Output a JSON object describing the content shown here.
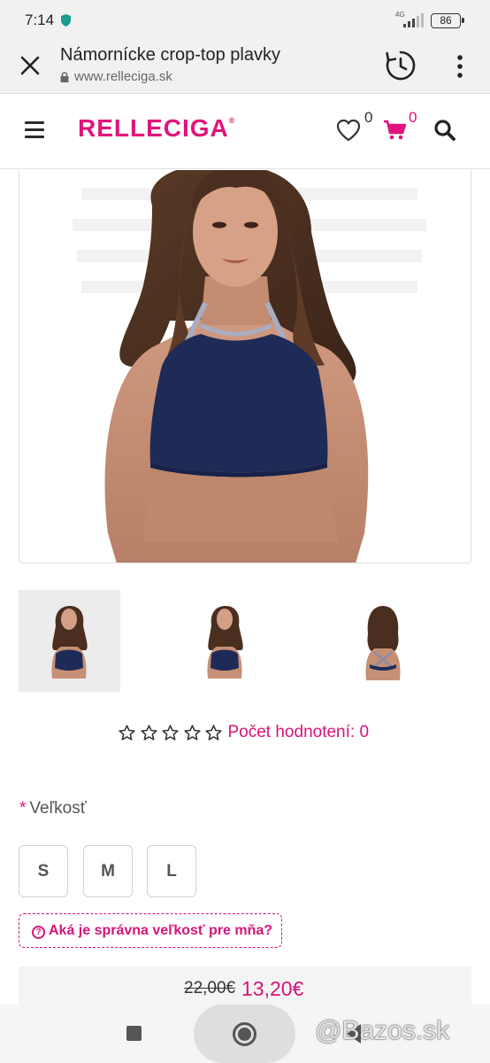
{
  "status_bar": {
    "time": "7:14",
    "network": "4G",
    "battery": "86"
  },
  "tab": {
    "title": "Námornícke crop-top plavky",
    "url": "www.relleciga.sk"
  },
  "site": {
    "logo": "RELLECIGA",
    "logo_mark": "®",
    "wishlist_count": "0",
    "cart_count": "0",
    "brand_color": "#e0137b"
  },
  "product": {
    "rating": {
      "stars": 0,
      "max_stars": 5,
      "label": "Počet hodnotení: 0"
    },
    "size": {
      "required_mark": "*",
      "label": "Veľkosť",
      "options": [
        "S",
        "M",
        "L"
      ]
    },
    "size_guide": {
      "label": "Aká je správna veľkosť pre mňa?",
      "icon": "question-circle-icon"
    },
    "price": {
      "old": "22,00€",
      "new": "13,20€"
    }
  },
  "watermark": "@Bazos.sk",
  "icons": {
    "close": "close-icon",
    "history": "history-icon",
    "menu": "more-vert-icon",
    "hamburger": "hamburger-icon",
    "wishlist": "heart-icon",
    "cart": "cart-icon",
    "search": "search-icon",
    "star": "star-outline-icon"
  }
}
